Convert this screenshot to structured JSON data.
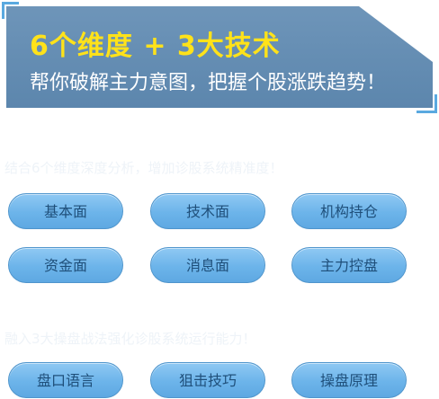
{
  "banner": {
    "headline": "6个维度 + 3大技术",
    "slogan": "帮你破解主力意图，把握个股涨跌趋势！"
  },
  "dimensions": {
    "caption": "结合6个维度深度分析，增加诊股系统精准度！",
    "buttons": [
      "基本面",
      "技术面",
      "机构持仓",
      "资金面",
      "消息面",
      "主力控盘"
    ]
  },
  "techniques": {
    "caption": "融入3大操盘战法强化诊股系统运行能力！",
    "buttons": [
      "盘口语言",
      "狙击技巧",
      "操盘原理"
    ]
  },
  "colors": {
    "banner_bg": "#6a91b6",
    "headline": "#ffe21a",
    "pill_fill": "#6cb4ea",
    "pill_text": "#1f4f7a",
    "corner_accent": "#5aa9e0"
  }
}
